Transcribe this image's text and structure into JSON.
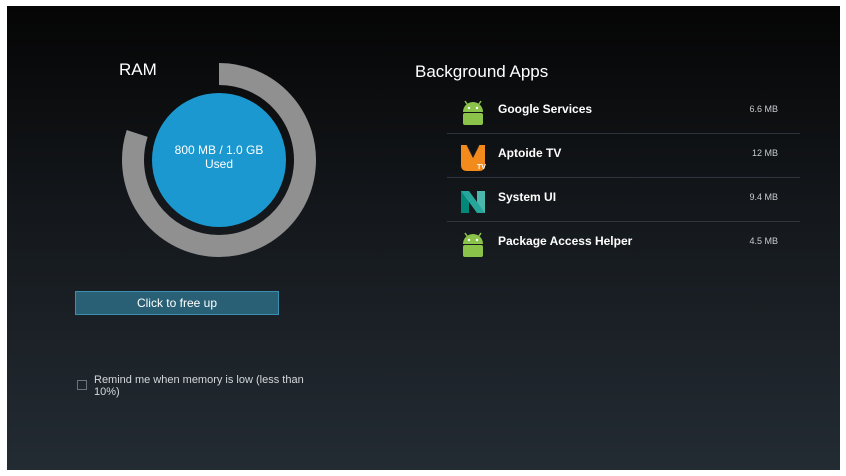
{
  "ram": {
    "title": "RAM",
    "usage_text": "800 MB / 1.0 GB",
    "usage_sub": "Used",
    "used_fraction": 0.8,
    "inner_color": "#1b98d0",
    "ring_color": "#909090"
  },
  "free_button": {
    "label": "Click to free up"
  },
  "remind": {
    "label": "Remind me when memory is low (less than 10%)",
    "checked": false
  },
  "background_apps": {
    "title": "Background Apps",
    "items": [
      {
        "name": "Google Services",
        "size": "6.6 MB",
        "icon": "android-icon"
      },
      {
        "name": "Aptoide TV",
        "size": "12 MB",
        "icon": "aptoide-tv-icon"
      },
      {
        "name": "System UI",
        "size": "9.4 MB",
        "icon": "android-n-icon"
      },
      {
        "name": "Package Access Helper",
        "size": "4.5 MB",
        "icon": "android-icon"
      }
    ]
  }
}
